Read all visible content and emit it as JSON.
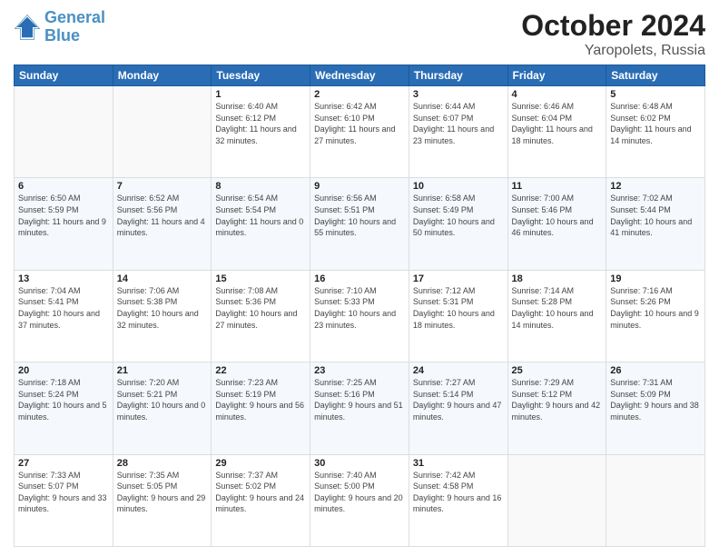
{
  "header": {
    "logo_line1": "General",
    "logo_line2": "Blue",
    "title": "October 2024",
    "subtitle": "Yaropolets, Russia"
  },
  "weekdays": [
    "Sunday",
    "Monday",
    "Tuesday",
    "Wednesday",
    "Thursday",
    "Friday",
    "Saturday"
  ],
  "weeks": [
    [
      {
        "day": "",
        "info": ""
      },
      {
        "day": "",
        "info": ""
      },
      {
        "day": "1",
        "info": "Sunrise: 6:40 AM\nSunset: 6:12 PM\nDaylight: 11 hours and 32 minutes."
      },
      {
        "day": "2",
        "info": "Sunrise: 6:42 AM\nSunset: 6:10 PM\nDaylight: 11 hours and 27 minutes."
      },
      {
        "day": "3",
        "info": "Sunrise: 6:44 AM\nSunset: 6:07 PM\nDaylight: 11 hours and 23 minutes."
      },
      {
        "day": "4",
        "info": "Sunrise: 6:46 AM\nSunset: 6:04 PM\nDaylight: 11 hours and 18 minutes."
      },
      {
        "day": "5",
        "info": "Sunrise: 6:48 AM\nSunset: 6:02 PM\nDaylight: 11 hours and 14 minutes."
      }
    ],
    [
      {
        "day": "6",
        "info": "Sunrise: 6:50 AM\nSunset: 5:59 PM\nDaylight: 11 hours and 9 minutes."
      },
      {
        "day": "7",
        "info": "Sunrise: 6:52 AM\nSunset: 5:56 PM\nDaylight: 11 hours and 4 minutes."
      },
      {
        "day": "8",
        "info": "Sunrise: 6:54 AM\nSunset: 5:54 PM\nDaylight: 11 hours and 0 minutes."
      },
      {
        "day": "9",
        "info": "Sunrise: 6:56 AM\nSunset: 5:51 PM\nDaylight: 10 hours and 55 minutes."
      },
      {
        "day": "10",
        "info": "Sunrise: 6:58 AM\nSunset: 5:49 PM\nDaylight: 10 hours and 50 minutes."
      },
      {
        "day": "11",
        "info": "Sunrise: 7:00 AM\nSunset: 5:46 PM\nDaylight: 10 hours and 46 minutes."
      },
      {
        "day": "12",
        "info": "Sunrise: 7:02 AM\nSunset: 5:44 PM\nDaylight: 10 hours and 41 minutes."
      }
    ],
    [
      {
        "day": "13",
        "info": "Sunrise: 7:04 AM\nSunset: 5:41 PM\nDaylight: 10 hours and 37 minutes."
      },
      {
        "day": "14",
        "info": "Sunrise: 7:06 AM\nSunset: 5:38 PM\nDaylight: 10 hours and 32 minutes."
      },
      {
        "day": "15",
        "info": "Sunrise: 7:08 AM\nSunset: 5:36 PM\nDaylight: 10 hours and 27 minutes."
      },
      {
        "day": "16",
        "info": "Sunrise: 7:10 AM\nSunset: 5:33 PM\nDaylight: 10 hours and 23 minutes."
      },
      {
        "day": "17",
        "info": "Sunrise: 7:12 AM\nSunset: 5:31 PM\nDaylight: 10 hours and 18 minutes."
      },
      {
        "day": "18",
        "info": "Sunrise: 7:14 AM\nSunset: 5:28 PM\nDaylight: 10 hours and 14 minutes."
      },
      {
        "day": "19",
        "info": "Sunrise: 7:16 AM\nSunset: 5:26 PM\nDaylight: 10 hours and 9 minutes."
      }
    ],
    [
      {
        "day": "20",
        "info": "Sunrise: 7:18 AM\nSunset: 5:24 PM\nDaylight: 10 hours and 5 minutes."
      },
      {
        "day": "21",
        "info": "Sunrise: 7:20 AM\nSunset: 5:21 PM\nDaylight: 10 hours and 0 minutes."
      },
      {
        "day": "22",
        "info": "Sunrise: 7:23 AM\nSunset: 5:19 PM\nDaylight: 9 hours and 56 minutes."
      },
      {
        "day": "23",
        "info": "Sunrise: 7:25 AM\nSunset: 5:16 PM\nDaylight: 9 hours and 51 minutes."
      },
      {
        "day": "24",
        "info": "Sunrise: 7:27 AM\nSunset: 5:14 PM\nDaylight: 9 hours and 47 minutes."
      },
      {
        "day": "25",
        "info": "Sunrise: 7:29 AM\nSunset: 5:12 PM\nDaylight: 9 hours and 42 minutes."
      },
      {
        "day": "26",
        "info": "Sunrise: 7:31 AM\nSunset: 5:09 PM\nDaylight: 9 hours and 38 minutes."
      }
    ],
    [
      {
        "day": "27",
        "info": "Sunrise: 7:33 AM\nSunset: 5:07 PM\nDaylight: 9 hours and 33 minutes."
      },
      {
        "day": "28",
        "info": "Sunrise: 7:35 AM\nSunset: 5:05 PM\nDaylight: 9 hours and 29 minutes."
      },
      {
        "day": "29",
        "info": "Sunrise: 7:37 AM\nSunset: 5:02 PM\nDaylight: 9 hours and 24 minutes."
      },
      {
        "day": "30",
        "info": "Sunrise: 7:40 AM\nSunset: 5:00 PM\nDaylight: 9 hours and 20 minutes."
      },
      {
        "day": "31",
        "info": "Sunrise: 7:42 AM\nSunset: 4:58 PM\nDaylight: 9 hours and 16 minutes."
      },
      {
        "day": "",
        "info": ""
      },
      {
        "day": "",
        "info": ""
      }
    ]
  ]
}
